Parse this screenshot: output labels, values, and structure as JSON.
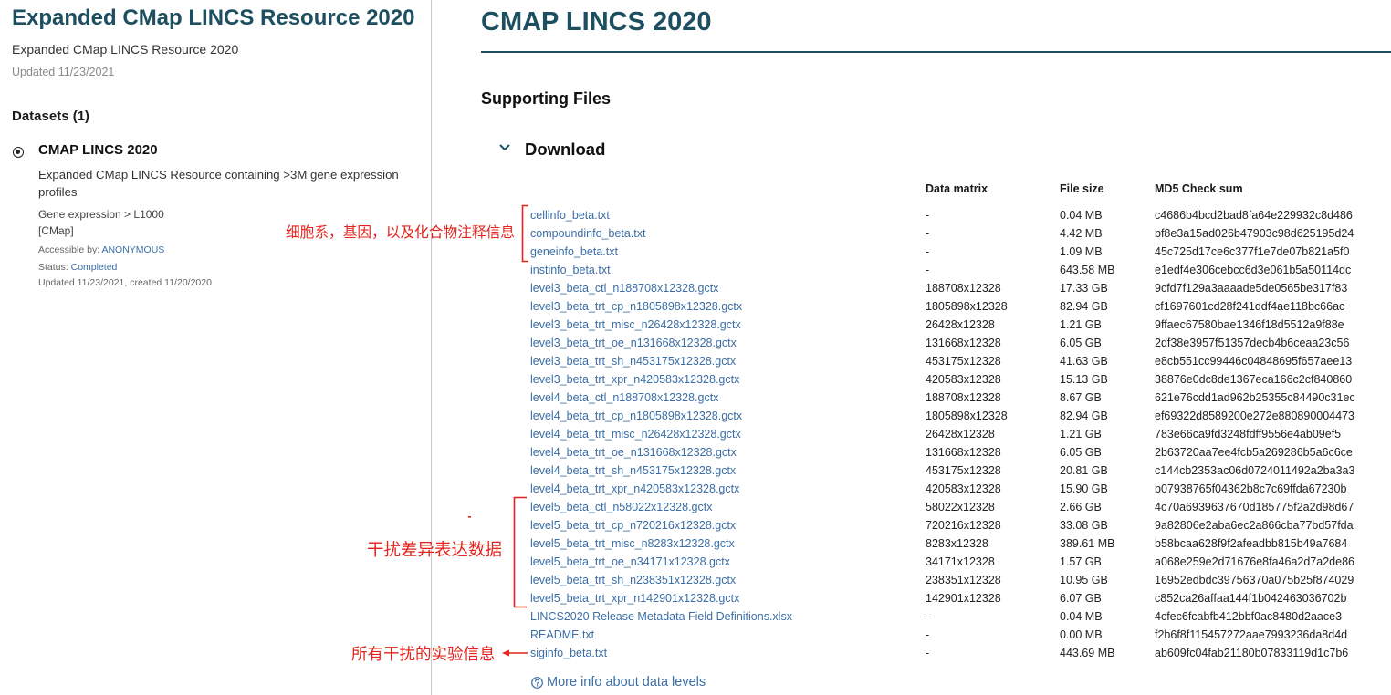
{
  "sidebar": {
    "title": "Expanded CMap LINCS Resource 2020",
    "subtitle": "Expanded CMap LINCS Resource 2020",
    "updated": "Updated 11/23/2021",
    "datasets_heading": "Datasets (1)",
    "dataset": {
      "title": "CMAP LINCS 2020",
      "description": "Expanded CMap LINCS Resource containing >3M gene expression profiles",
      "category": "Gene expression > L1000",
      "group": "[CMap]",
      "accessible_label": "Accessible by:",
      "accessible_value": "ANONYMOUS",
      "status_label": "Status:",
      "status_value": "Completed",
      "dates": "Updated 11/23/2021, created 11/20/2020"
    }
  },
  "main": {
    "title": "CMAP LINCS 2020",
    "section_title": "Supporting Files",
    "download": {
      "label": "Download",
      "columns": [
        "Data matrix",
        "File size",
        "MD5 Check sum"
      ],
      "files": [
        {
          "name": "cellinfo_beta.txt",
          "matrix": "-",
          "size": "0.04 MB",
          "md5": "c4686b4bcd2bad8fa64e229932c8d486"
        },
        {
          "name": "compoundinfo_beta.txt",
          "matrix": "-",
          "size": "4.42 MB",
          "md5": "bf8e3a15ad026b47903c98d625195d24"
        },
        {
          "name": "geneinfo_beta.txt",
          "matrix": "-",
          "size": "1.09 MB",
          "md5": "45c725d17ce6c377f1e7de07b821a5f0"
        },
        {
          "name": "instinfo_beta.txt",
          "matrix": "-",
          "size": "643.58 MB",
          "md5": "e1edf4e306cebcc6d3e061b5a50114dc"
        },
        {
          "name": "level3_beta_ctl_n188708x12328.gctx",
          "matrix": "188708x12328",
          "size": "17.33 GB",
          "md5": "9cfd7f129a3aaaade5de0565be317f83"
        },
        {
          "name": "level3_beta_trt_cp_n1805898x12328.gctx",
          "matrix": "1805898x12328",
          "size": "82.94 GB",
          "md5": "cf1697601cd28f241ddf4ae118bc66ac"
        },
        {
          "name": "level3_beta_trt_misc_n26428x12328.gctx",
          "matrix": "26428x12328",
          "size": "1.21 GB",
          "md5": "9ffaec67580bae1346f18d5512a9f88e"
        },
        {
          "name": "level3_beta_trt_oe_n131668x12328.gctx",
          "matrix": "131668x12328",
          "size": "6.05 GB",
          "md5": "2df38e3957f51357decb4b6ceaa23c56"
        },
        {
          "name": "level3_beta_trt_sh_n453175x12328.gctx",
          "matrix": "453175x12328",
          "size": "41.63 GB",
          "md5": "e8cb551cc99446c04848695f657aee13"
        },
        {
          "name": "level3_beta_trt_xpr_n420583x12328.gctx",
          "matrix": "420583x12328",
          "size": "15.13 GB",
          "md5": "38876e0dc8de1367eca166c2cf840860"
        },
        {
          "name": "level4_beta_ctl_n188708x12328.gctx",
          "matrix": "188708x12328",
          "size": "8.67 GB",
          "md5": "621e76cdd1ad962b25355c84490c31ec"
        },
        {
          "name": "level4_beta_trt_cp_n1805898x12328.gctx",
          "matrix": "1805898x12328",
          "size": "82.94 GB",
          "md5": "ef69322d8589200e272e880890004473"
        },
        {
          "name": "level4_beta_trt_misc_n26428x12328.gctx",
          "matrix": "26428x12328",
          "size": "1.21 GB",
          "md5": "783e66ca9fd3248fdff9556e4ab09ef5"
        },
        {
          "name": "level4_beta_trt_oe_n131668x12328.gctx",
          "matrix": "131668x12328",
          "size": "6.05 GB",
          "md5": "2b63720aa7ee4fcb5a269286b5a6c6ce"
        },
        {
          "name": "level4_beta_trt_sh_n453175x12328.gctx",
          "matrix": "453175x12328",
          "size": "20.81 GB",
          "md5": "c144cb2353ac06d0724011492a2ba3a3"
        },
        {
          "name": "level4_beta_trt_xpr_n420583x12328.gctx",
          "matrix": "420583x12328",
          "size": "15.90 GB",
          "md5": "b07938765f04362b8c7c69ffda67230b"
        },
        {
          "name": "level5_beta_ctl_n58022x12328.gctx",
          "matrix": "58022x12328",
          "size": "2.66 GB",
          "md5": "4c70a6939637670d185775f2a2d98d67"
        },
        {
          "name": "level5_beta_trt_cp_n720216x12328.gctx",
          "matrix": "720216x12328",
          "size": "33.08 GB",
          "md5": "9a82806e2aba6ec2a866cba77bd57fda"
        },
        {
          "name": "level5_beta_trt_misc_n8283x12328.gctx",
          "matrix": "8283x12328",
          "size": "389.61 MB",
          "md5": "b58bcaa628f9f2afeadbb815b49a7684"
        },
        {
          "name": "level5_beta_trt_oe_n34171x12328.gctx",
          "matrix": "34171x12328",
          "size": "1.57 GB",
          "md5": "a068e259e2d71676e8fa46a2d7a2de86"
        },
        {
          "name": "level5_beta_trt_sh_n238351x12328.gctx",
          "matrix": "238351x12328",
          "size": "10.95 GB",
          "md5": "16952edbdc39756370a075b25f874029"
        },
        {
          "name": "level5_beta_trt_xpr_n142901x12328.gctx",
          "matrix": "142901x12328",
          "size": "6.07 GB",
          "md5": "c852ca26affaa144f1b042463036702b"
        },
        {
          "name": "LINCS2020 Release Metadata Field Definitions.xlsx",
          "matrix": "-",
          "size": "0.04 MB",
          "md5": "4cfec6fcabfb412bbf0ac8480d2aace3"
        },
        {
          "name": "README.txt",
          "matrix": "-",
          "size": "0.00 MB",
          "md5": "f2b6f8f115457272aae7993236da8d4d"
        },
        {
          "name": "siginfo_beta.txt",
          "matrix": "-",
          "size": "443.69 MB",
          "md5": "ab609fc04fab21180b07833119d1c7b6"
        }
      ]
    },
    "more_info": "More info about data levels"
  },
  "annotations": {
    "metadata_note": "细胞系，基因，以及化合物注释信息",
    "level5_note": "干扰差异表达数据",
    "siginfo_note": "所有干扰的实验信息"
  },
  "icons": {
    "dataset_radio": "radio-selected-icon",
    "download_toggle": "chevron-down-icon",
    "more_info": "question-circle-icon"
  },
  "colors": {
    "heading_teal": "#1d4f60",
    "link_blue": "#3b6ea6",
    "annotation_red": "#e3231c",
    "divider": "#c8c8c8"
  }
}
